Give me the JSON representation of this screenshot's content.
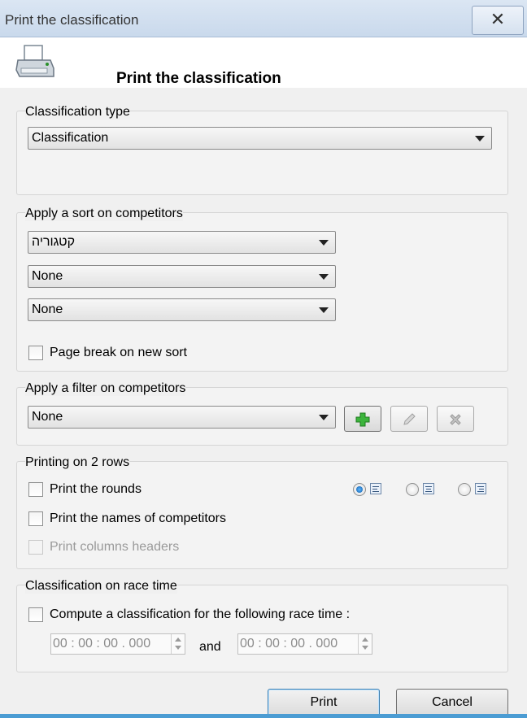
{
  "window": {
    "title": "Print the classification",
    "close_icon": "close-icon"
  },
  "header": {
    "title": "Print the classification",
    "icon": "printer-icon"
  },
  "classification_type": {
    "title": "Classification type",
    "selected": "Classification"
  },
  "sort": {
    "title": "Apply a sort on competitors",
    "sort1": "קטגוריה",
    "sort2": "None",
    "sort3": "None",
    "page_break_label": "Page break on new sort",
    "page_break_checked": false
  },
  "filter": {
    "title": "Apply a filter on competitors",
    "selected": "None",
    "buttons": [
      "add-icon",
      "edit-icon",
      "delete-icon"
    ]
  },
  "two_rows": {
    "title": "Printing on 2 rows",
    "print_rounds_label": "Print the rounds",
    "print_names_label": "Print the names of competitors",
    "print_headers_label": "Print columns headers",
    "alignment_options": [
      "align-left",
      "align-center",
      "align-right"
    ],
    "alignment_selected": "align-left"
  },
  "race_time": {
    "title": "Classification on race time",
    "compute_label": "Compute a classification for the following race time :",
    "from_value": "00 : 00 : 00 . 000",
    "and_label": "and",
    "to_value": "00 : 00 : 00 . 000"
  },
  "buttons": {
    "print": "Print",
    "cancel": "Cancel"
  },
  "colors": {
    "title_bar": "#c9d9ec",
    "accent": "#4b9cd3",
    "add_green": "#2ea12e"
  }
}
